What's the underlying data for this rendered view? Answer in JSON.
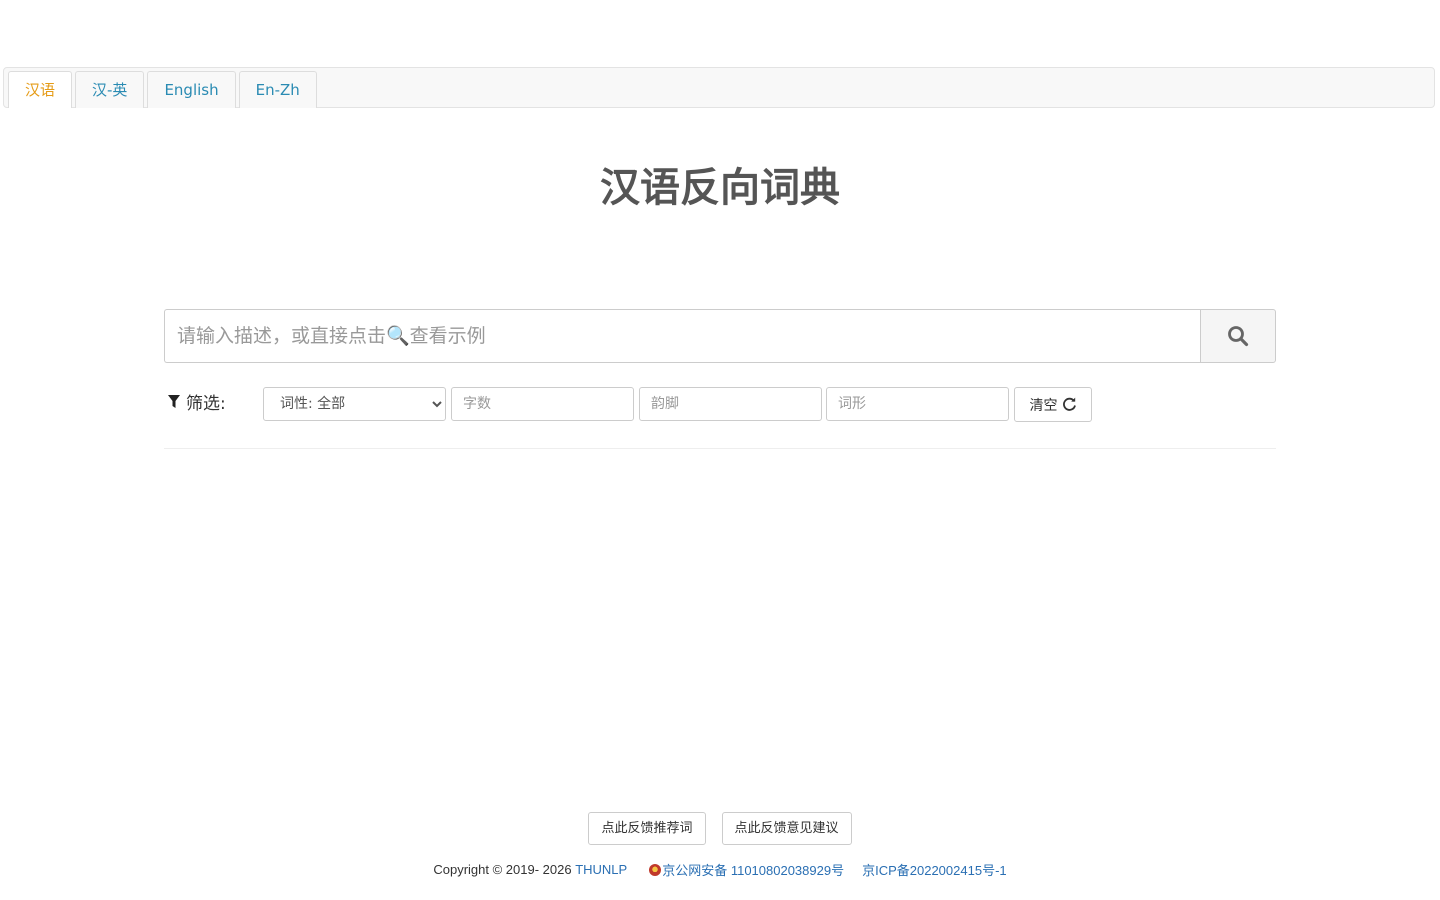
{
  "tabs": [
    {
      "label": "汉语",
      "active": true
    },
    {
      "label": "汉-英",
      "active": false
    },
    {
      "label": "English",
      "active": false
    },
    {
      "label": "En-Zh",
      "active": false
    }
  ],
  "title": "汉语反向词典",
  "search": {
    "placeholder": "请输入描述，或直接点击🔍查看示例",
    "value": "",
    "button_icon": "search-icon"
  },
  "filter": {
    "label": "筛选:",
    "icon": "filter-icon",
    "pos_select": {
      "selected": "词性: 全部"
    },
    "char_count_placeholder": "字数",
    "rhyme_placeholder": "韵脚",
    "form_placeholder": "词形",
    "clear_label": "清空",
    "clear_icon": "refresh-icon"
  },
  "feedback": {
    "recommend_label": "点此反馈推荐词",
    "suggest_label": "点此反馈意见建议"
  },
  "footer": {
    "copyright": "Copyright © 2019- 2026 ",
    "org_link": "THUNLP",
    "police_record": "京公网安备 11010802038929号",
    "icp_record": "京ICP备2022002415号-1"
  },
  "colors": {
    "tab_link": "#2a8bb3",
    "tab_active": "#e59b16",
    "footer_link": "#2a6fb3"
  }
}
